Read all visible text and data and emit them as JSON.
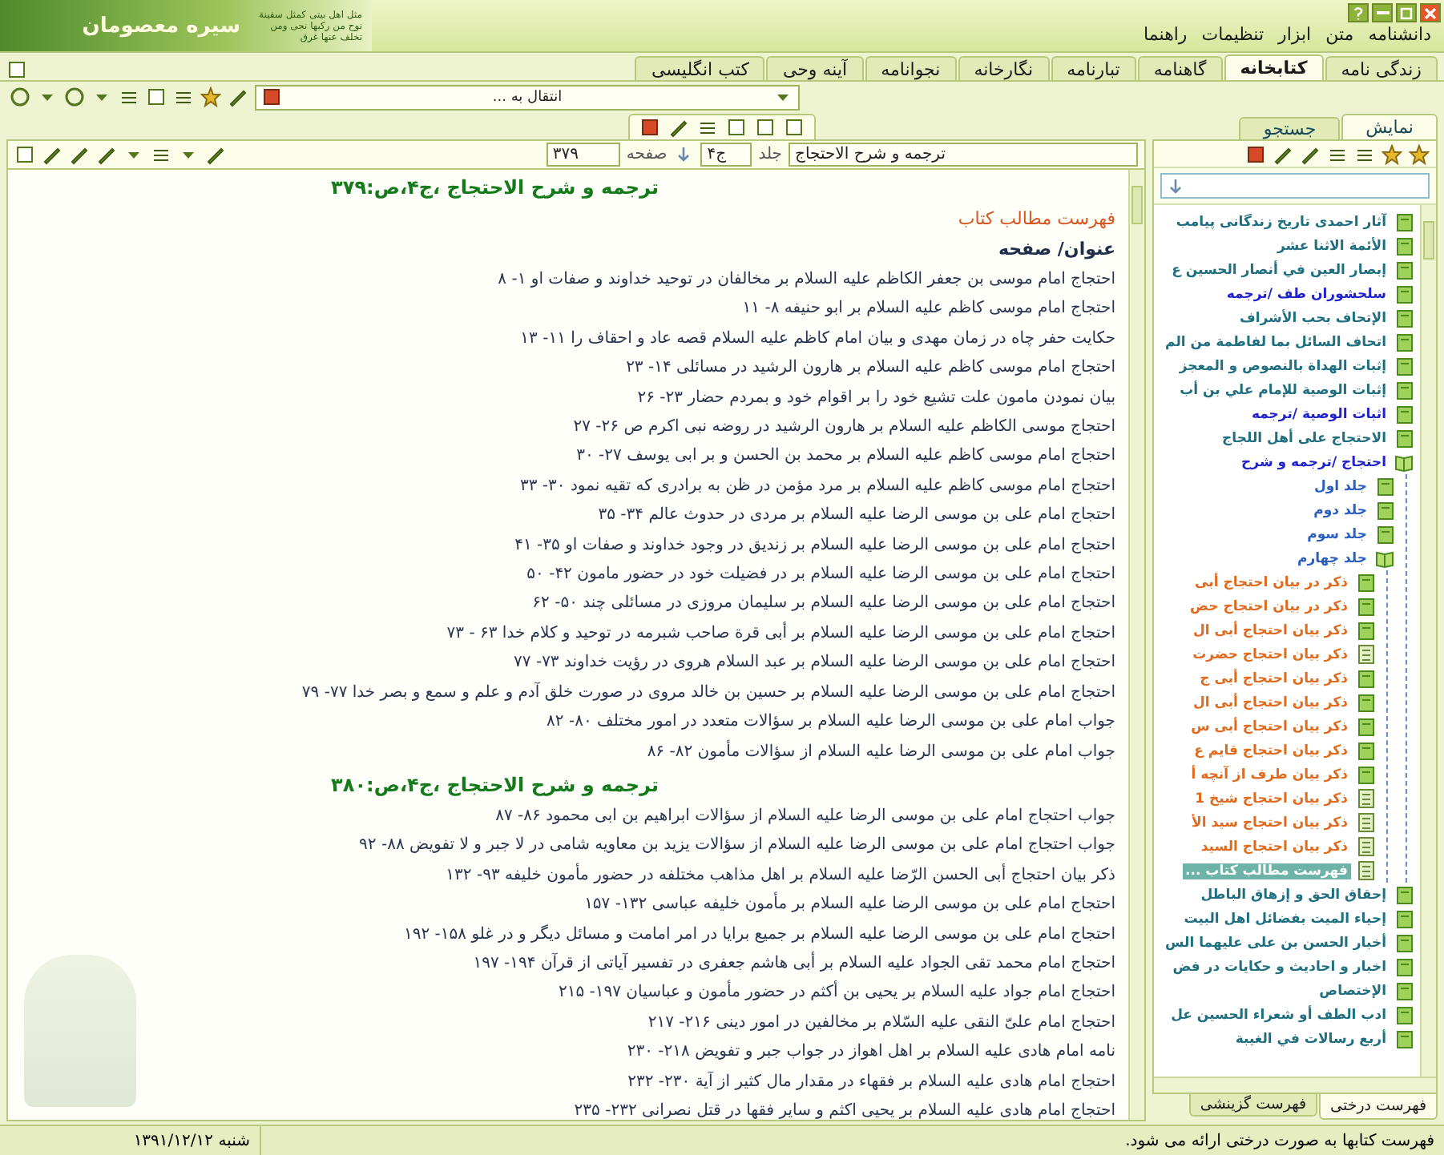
{
  "logo": {
    "title": "سیره معصومان",
    "motto": "مثل اهل بیتی کمثل سفینة نوح من رکبها نجی ومن تخلف عنها غرق"
  },
  "menu": [
    "دانشنامه",
    "متن",
    "ابزار",
    "تنظیمات",
    "راهنما"
  ],
  "tabs": [
    {
      "label": "زندگی نامه",
      "selected": false
    },
    {
      "label": "کتابخانه",
      "selected": true
    },
    {
      "label": "گاهنامه",
      "selected": false
    },
    {
      "label": "تبارنامه",
      "selected": false
    },
    {
      "label": "نگارخانه",
      "selected": false
    },
    {
      "label": "نجوانامه",
      "selected": false
    },
    {
      "label": "آینه وحی",
      "selected": false
    },
    {
      "label": "کتب انگلیسی",
      "selected": false
    }
  ],
  "goto": "انتقال به ...",
  "side_tabs": [
    {
      "label": "نمایش",
      "selected": true
    },
    {
      "label": "جستجو",
      "selected": false
    }
  ],
  "tree": [
    {
      "label": "آثار احمدی تاریخ زندگانی پیامب",
      "kind": "book",
      "color": "#1f6f80",
      "selected": false
    },
    {
      "label": "الأئمة الاثنا عشر",
      "kind": "book",
      "color": "#1f6f80",
      "selected": false
    },
    {
      "label": "إبصار العين في أنصار الحسين ع",
      "kind": "book",
      "color": "#1f6f80",
      "selected": false
    },
    {
      "label": "سلحشوران طف /ترجمه",
      "kind": "book",
      "color": "#2222cc",
      "selected": false
    },
    {
      "label": "الإتحاف بحب الأشراف",
      "kind": "book",
      "color": "#1f6f80",
      "selected": false
    },
    {
      "label": "اتحاف السائل بما لفاطمة من الم",
      "kind": "book",
      "color": "#1f6f80",
      "selected": false
    },
    {
      "label": "إثبات الهداة بالنصوص و المعجز",
      "kind": "book",
      "color": "#1f6f80",
      "selected": false
    },
    {
      "label": "إثبات الوصية للإمام علي بن أب",
      "kind": "book",
      "color": "#1f6f80",
      "selected": false
    },
    {
      "label": "اثبات الوصية /ترجمه",
      "kind": "book",
      "color": "#2222cc",
      "selected": false
    },
    {
      "label": "الاحتجاج على أهل اللجاج",
      "kind": "book",
      "color": "#1f6f80",
      "selected": false
    },
    {
      "label": "احتجاج /ترجمه و شرح",
      "color": "#2222cc",
      "selected": false,
      "expanded": true,
      "children": [
        {
          "label": "جلد اول",
          "kind": "book",
          "color": "#2a5fc0",
          "selected": false
        },
        {
          "label": "جلد دوم",
          "kind": "book",
          "color": "#2a5fc0",
          "selected": false
        },
        {
          "label": "جلد سوم",
          "kind": "book",
          "color": "#2a5fc0",
          "selected": false
        },
        {
          "label": "جلد چهارم",
          "color": "#2a5fc0",
          "selected": false,
          "expanded": true,
          "children": [
            {
              "label": "ذکر در بیان احتجاج أبی",
              "kind": "book",
              "color": "#e06a1e",
              "selected": false
            },
            {
              "label": "ذکر در بیان احتجاج حض",
              "kind": "book",
              "color": "#e06a1e",
              "selected": false
            },
            {
              "label": "ذکر بیان احتجاج أبی ال",
              "kind": "book",
              "color": "#e06a1e",
              "selected": false
            },
            {
              "label": "ذکر بیان احتجاج حضرت",
              "kind": "page",
              "color": "#e06a1e",
              "selected": false
            },
            {
              "label": "ذکر بیان احتجاج أبی ج",
              "kind": "book",
              "color": "#e06a1e",
              "selected": false
            },
            {
              "label": "ذکر بیان احتجاج أبی ال",
              "kind": "book",
              "color": "#e06a1e",
              "selected": false
            },
            {
              "label": "ذکر بیان احتجاج أبی س",
              "kind": "book",
              "color": "#e06a1e",
              "selected": false
            },
            {
              "label": "ذکر بیان احتجاج قایم ع",
              "kind": "book",
              "color": "#e06a1e",
              "selected": false
            },
            {
              "label": "ذکر بیان طرف از آنچه أ",
              "kind": "book",
              "color": "#e06a1e",
              "selected": false
            },
            {
              "label": "ذکر بیان احتجاج شیخ 1",
              "kind": "page",
              "color": "#e06a1e",
              "selected": false
            },
            {
              "label": "ذکر بیان احتجاج سید الأ",
              "kind": "page",
              "color": "#e06a1e",
              "selected": false
            },
            {
              "label": "ذکر بیان احتجاج السید",
              "kind": "page",
              "color": "#e06a1e",
              "selected": false
            },
            {
              "label": "فهرست مطالب کتاب ...",
              "kind": "page",
              "selected": true
            }
          ]
        }
      ]
    },
    {
      "label": "إحقاق الحق و إزهاق الباطل",
      "kind": "book",
      "color": "#1f6f80",
      "selected": false
    },
    {
      "label": "إحياء الميت بفضائل اهل البيت",
      "kind": "book",
      "color": "#1f6f80",
      "selected": false
    },
    {
      "label": "أخبار الحسن بن على عليهما الس",
      "kind": "book",
      "color": "#1f6f80",
      "selected": false
    },
    {
      "label": "اخبار و احادیث و حکایات در فض",
      "kind": "book",
      "color": "#1f6f80",
      "selected": false
    },
    {
      "label": "الإختصاص",
      "kind": "book",
      "color": "#1f6f80",
      "selected": false
    },
    {
      "label": "ادب الطف أو شعراء الحسين عل",
      "kind": "book",
      "color": "#1f6f80",
      "selected": false
    },
    {
      "label": "أربع رسالات في الغيبة",
      "kind": "book",
      "color": "#1f6f80",
      "selected": false
    }
  ],
  "bottom_tabs": [
    {
      "label": "فهرست درختی",
      "selected": true
    },
    {
      "label": "فهرست گزینشی",
      "selected": false
    }
  ],
  "document": {
    "book": "ترجمه و شرح الاحتجاج",
    "volume_label": "جلد",
    "volume": "ج۴",
    "page_label": "صفحه",
    "page": "۳۷۹",
    "blocks": [
      {
        "kind": "heading",
        "text": "ترجمه و شرح الاحتجاج ،ج۴،ص:۳۷۹"
      },
      {
        "kind": "title",
        "text": "فهرست مطالب کتاب"
      },
      {
        "kind": "header",
        "text": "عنوان/ صفحه"
      },
      {
        "kind": "entry",
        "text": "احتجاج امام موسى بن جعفر الكاظم عليه السلام بر مخالفان در توحيد خداوند و صفات او ۱- ۸"
      },
      {
        "kind": "entry",
        "text": "احتجاج امام موسى كاظم عليه السلام بر ابو حنيفه ۸- ۱۱"
      },
      {
        "kind": "entry",
        "text": "حكايت حفر چاه در زمان مهدى و بيان امام كاظم عليه السلام قصه عاد و احقاف را ۱۱- ۱۳"
      },
      {
        "kind": "entry",
        "text": "احتجاج امام موسى كاظم عليه السلام بر هارون الرشيد در مسائلى ۱۴- ۲۳"
      },
      {
        "kind": "entry",
        "text": "بيان نمودن مامون علت تشيع خود را بر اقوام خود و بمردم حضار ۲۳- ۲۶"
      },
      {
        "kind": "entry",
        "text": "احتجاج موسى الكاظم عليه السلام بر هارون الرشيد در روضه نبى اكرم ص ۲۶- ۲۷"
      },
      {
        "kind": "entry",
        "text": "احتجاج امام موسى كاظم عليه السلام بر محمد بن الحسن و بر ابى يوسف ۲۷- ۳۰"
      },
      {
        "kind": "entry",
        "text": "احتجاج امام موسى كاظم عليه السلام بر مرد مؤمن در ظن به برادرى كه تقيه نمود ۳۰- ۳۳"
      },
      {
        "kind": "entry",
        "text": "احتجاج امام على بن موسى الرضا عليه السلام بر مردى در حدوث عالم ۳۴- ۳۵"
      },
      {
        "kind": "entry",
        "text": "احتجاج امام على بن موسى الرضا عليه السلام بر زنديق در وجود خداوند و صفات او ۳۵- ۴۱"
      },
      {
        "kind": "entry",
        "text": "احتجاج امام على بن موسى الرضا عليه السلام بر در فضيلت خود در حضور مامون ۴۲- ۵۰"
      },
      {
        "kind": "entry",
        "text": "احتجاج امام على بن موسى الرضا عليه السلام بر سليمان مروزى در مسائلى چند ۵۰- ۶۲"
      },
      {
        "kind": "entry",
        "text": "احتجاج امام على بن موسى الرضا عليه السلام بر أبى قرة صاحب شبرمه در توحيد و كلام خدا ۶۳ - ۷۳"
      },
      {
        "kind": "entry",
        "text": "احتجاج امام على بن موسى الرضا عليه السلام بر عبد السلام هروى در رؤيت خداوند ۷۳- ۷۷"
      },
      {
        "kind": "entry",
        "text": "احتجاج امام على بن موسى الرضا عليه السلام بر حسين بن خالد مروى در صورت خلق آدم و علم و سمع و بصر خدا ۷۷- ۷۹"
      },
      {
        "kind": "entry",
        "text": "جواب امام على بن موسى الرضا عليه السلام بر سؤالات متعدد در امور مختلف ۸۰- ۸۲"
      },
      {
        "kind": "entry",
        "text": "جواب امام على بن موسى الرضا عليه السلام از سؤالات مأمون ۸۲- ۸۶"
      },
      {
        "kind": "heading",
        "text": "ترجمه و شرح الاحتجاج ،ج۴،ص:۳۸۰"
      },
      {
        "kind": "entry",
        "text": "جواب احتجاج امام على بن موسى الرضا عليه السلام از سؤالات ابراهيم بن ابى محمود ۸۶- ۸۷"
      },
      {
        "kind": "entry",
        "text": "جواب احتجاج امام على بن موسى الرضا عليه السلام از سؤالات يزيد بن معاويه شامى در لا جبر و لا تفويض ۸۸- ۹۲"
      },
      {
        "kind": "entry",
        "text": "ذكر بيان احتجاج أبى الحسن الرّضا عليه السلام بر اهل مذاهب مختلفه در حضور مأمون خليفه ۹۳- ۱۳۲"
      },
      {
        "kind": "entry",
        "text": "احتجاج امام على بن موسى الرضا عليه السلام بر مأمون خليفه عباسى ۱۳۲- ۱۵۷"
      },
      {
        "kind": "entry",
        "text": "احتجاج امام على بن موسى الرضا عليه السلام بر جميع برايا در امر امامت و مسائل ديگر و در غلو ۱۵۸- ۱۹۲"
      },
      {
        "kind": "entry",
        "text": "احتجاج امام محمد تقى الجواد عليه السلام بر أبى هاشم جعفرى در تفسير آياتى از قرآن ۱۹۴- ۱۹۷"
      },
      {
        "kind": "entry",
        "text": "احتجاج امام جواد عليه السلام بر يحيى بن أكثم در حضور مأمون و عباسيان ۱۹۷- ۲۱۵"
      },
      {
        "kind": "entry",
        "text": "احتجاج امام علىّ النقى عليه السّلام بر مخالفين در امور دينى ۲۱۶- ۲۱۷"
      },
      {
        "kind": "entry",
        "text": "نامه امام هادى عليه السلام بر اهل اهواز در جواب جبر و تفويض ۲۱۸- ۲۳۰"
      },
      {
        "kind": "entry",
        "text": "احتجاج امام هادى عليه السلام بر فقهاء در مقدار مال كثير از آية ۲۳۰- ۲۳۲"
      },
      {
        "kind": "entry",
        "text": "احتجاج امام هادى عليه السلام بر يحيى اكثم و ساير فقها در قتل نصرانى ۲۳۲- ۲۳۵"
      }
    ]
  },
  "status": {
    "message": "فهرست کتابها به صورت درختی ارائه می شود.",
    "date": "شنبه ۱۳۹۱/۱۲/۱۲"
  }
}
